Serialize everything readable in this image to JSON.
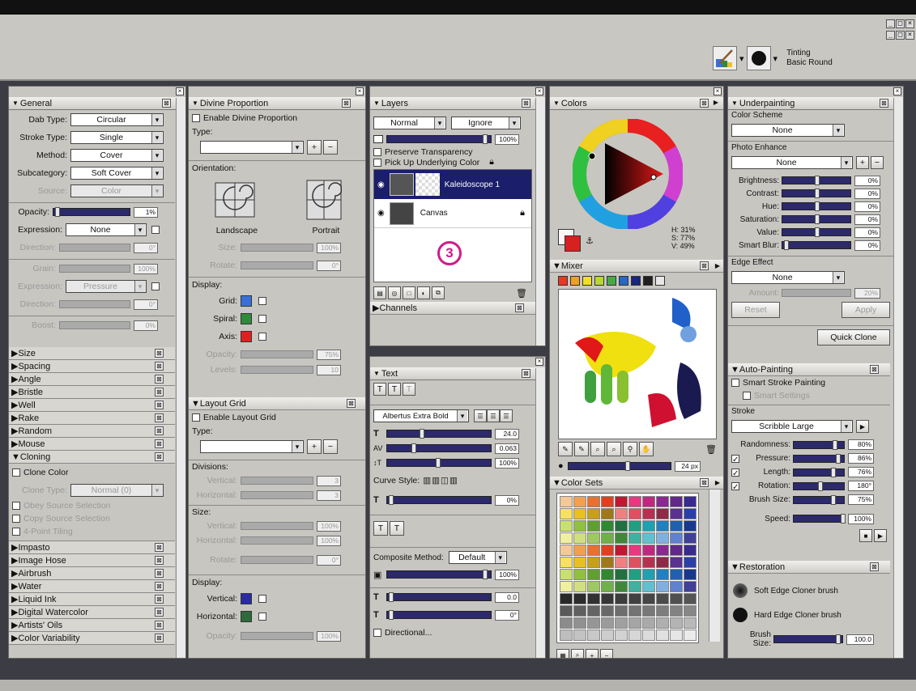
{
  "window": {
    "controls": [
      "_",
      "□",
      "×"
    ]
  },
  "brush": {
    "category": "Tinting",
    "variant": "Basic Round"
  },
  "general": {
    "title": "General",
    "dab_type_label": "Dab Type:",
    "dab_type": "Circular",
    "stroke_type_label": "Stroke Type:",
    "stroke_type": "Single",
    "method_label": "Method:",
    "method": "Cover",
    "subcategory_label": "Subcategory:",
    "subcategory": "Soft Cover",
    "source_label": "Source:",
    "source": "Color",
    "opacity_label": "Opacity:",
    "opacity": "1%",
    "opacity_level": 0.01,
    "expression_label": "Expression:",
    "expression": "None",
    "direction_label": "Direction:",
    "direction": "0°",
    "grain_label": "Grain:",
    "grain": "100%",
    "expression2": "Pressure",
    "direction2": "0°",
    "boost_label": "Boost:",
    "boost": "0%",
    "sections_a": [
      "Size",
      "Spacing",
      "Angle",
      "Bristle",
      "Well",
      "Rake",
      "Random",
      "Mouse"
    ],
    "cloning_title": "Cloning",
    "clone_color": "Clone Color",
    "clone_type_label": "Clone Type:",
    "clone_type": "Normal (0)",
    "obey_source": "Obey Source Selection",
    "copy_source": "Copy Source Selection",
    "four_point": "4-Point Tiling",
    "sections_b": [
      "Impasto",
      "Image Hose",
      "Airbrush",
      "Water",
      "Liquid Ink",
      "Digital Watercolor",
      "Artists' Oils",
      "Color Variability"
    ]
  },
  "divine": {
    "title": "Divine Proportion",
    "enable": "Enable Divine Proportion",
    "type_label": "Type:",
    "orientation_label": "Orientation:",
    "landscape": "Landscape",
    "portrait": "Portrait",
    "size_label": "Size:",
    "size": "100%",
    "rotate_label": "Rotate:",
    "rotate": "0°",
    "display_label": "Display:",
    "grid_label": "Grid:",
    "spiral_label": "Spiral:",
    "axis_label": "Axis:",
    "opacity_label": "Opacity:",
    "opacity": "75%",
    "levels_label": "Levels:",
    "levels": "10",
    "grid_color": "#3a6fd8",
    "spiral_color": "#2e8b3a",
    "axis_color": "#e02020"
  },
  "layout_grid": {
    "title": "Layout Grid",
    "enable": "Enable Layout Grid",
    "type_label": "Type:",
    "divisions_label": "Divisions:",
    "vertical_label": "Vertical:",
    "horizontal_label": "Horizontal:",
    "div_vertical": "3",
    "div_horizontal": "3",
    "size_label": "Size:",
    "size_vertical": "100%",
    "size_horizontal": "100%",
    "rotate_label": "Rotate:",
    "rotate": "0°",
    "display_label": "Display:",
    "opacity_label": "Opacity:",
    "opacity": "100%",
    "vertical_color": "#2a2aa8",
    "horizontal_color": "#2e6b3a"
  },
  "layers": {
    "title": "Layers",
    "blend": "Normal",
    "composite": "Ignore",
    "opacity": "100%",
    "preserve": "Preserve Transparency",
    "pickup": "Pick Up Underlying Color",
    "items": [
      "Kaleidoscope 1",
      "Canvas"
    ],
    "callout": "3",
    "channels": "Channels"
  },
  "text": {
    "title": "Text",
    "font": "Albertus Extra Bold",
    "size": "24.0",
    "tracking": "0.063",
    "leading": "100%",
    "curve_style_label": "Curve Style:",
    "angle": "0%",
    "composite_label": "Composite Method:",
    "composite": "Default",
    "opacity": "100%",
    "shadow_value": "0.0",
    "shadow_angle": "0°",
    "directional": "Directional..."
  },
  "colors": {
    "title": "Colors",
    "h": "H: 31%",
    "s": "S: 77%",
    "v": "V: 49%",
    "main": "#d82020",
    "secondary": "#f8f8f8"
  },
  "mixer": {
    "title": "Mixer",
    "swatches": [
      "#e83820",
      "#f0a020",
      "#f0e020",
      "#b8d830",
      "#48a848",
      "#2868c0",
      "#18287a",
      "#202020",
      "#e8e8e8"
    ],
    "brush_size": "24 px"
  },
  "color_sets": {
    "title": "Color Sets"
  },
  "underpainting": {
    "title": "Underpainting",
    "color_scheme_label": "Color Scheme",
    "color_scheme": "None",
    "photo_enhance_label": "Photo Enhance",
    "photo_enhance": "None",
    "brightness_label": "Brightness:",
    "brightness": "0%",
    "contrast_label": "Contrast:",
    "contrast": "0%",
    "hue_label": "Hue:",
    "hue": "0%",
    "saturation_label": "Saturation:",
    "saturation": "0%",
    "value_label": "Value:",
    "value": "0%",
    "smart_blur_label": "Smart Blur:",
    "smart_blur": "0%",
    "edge_label": "Edge Effect",
    "edge": "None",
    "amount_label": "Amount:",
    "amount": "20%",
    "reset": "Reset",
    "apply": "Apply",
    "quick_clone": "Quick Clone"
  },
  "auto_painting": {
    "title": "Auto-Painting",
    "smart_stroke": "Smart Stroke Painting",
    "smart_settings": "Smart Settings",
    "stroke_label": "Stroke",
    "stroke": "Scribble Large",
    "randomness_label": "Randomness:",
    "randomness": "80%",
    "pressure_label": "Pressure:",
    "pressure": "86%",
    "length_label": "Length:",
    "length": "76%",
    "rotation_label": "Rotation:",
    "rotation": "180°",
    "brush_size_label": "Brush Size:",
    "brush_size": "75%",
    "speed_label": "Speed:",
    "speed": "100%"
  },
  "restoration": {
    "title": "Restoration",
    "soft": "Soft Edge Cloner brush",
    "hard": "Hard Edge Cloner brush",
    "brush_size_label": "Brush Size:",
    "brush_size": "100.0"
  }
}
